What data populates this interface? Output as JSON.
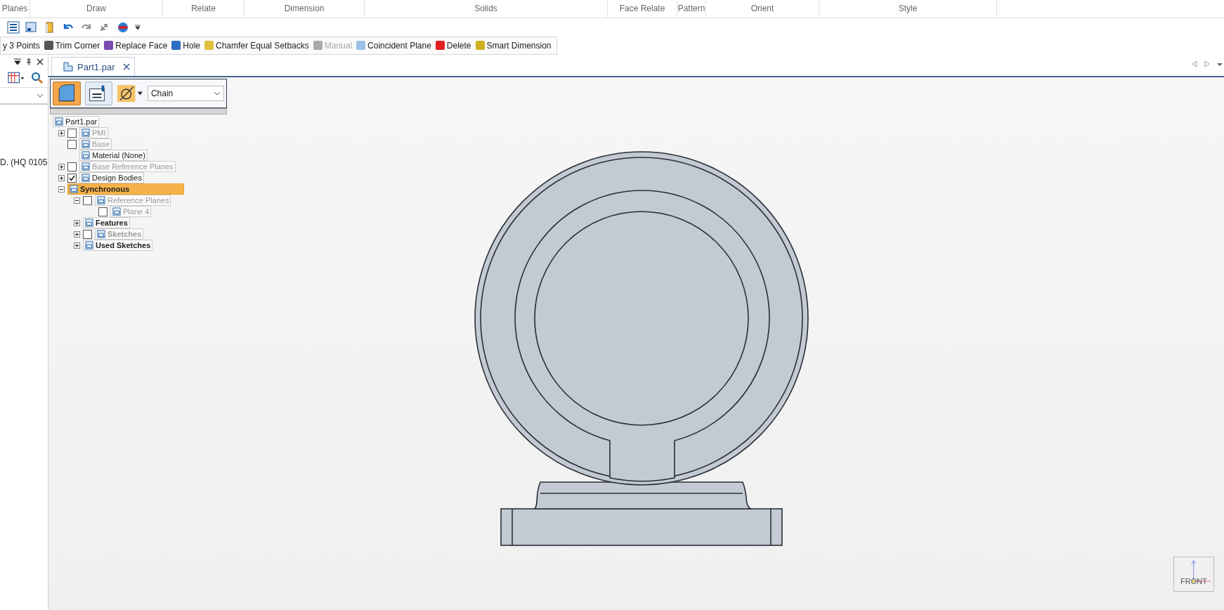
{
  "ribbon": {
    "groups": [
      "Planes",
      "Draw",
      "Relate",
      "Dimension",
      "Solids",
      "Face Relate",
      "Pattern",
      "Orient",
      "Style"
    ]
  },
  "command_bar": {
    "items": [
      {
        "label": "y 3 Points",
        "disabled": false
      },
      {
        "label": "Trim Corner",
        "disabled": false
      },
      {
        "label": "Replace Face",
        "disabled": false
      },
      {
        "label": "Hole",
        "disabled": false
      },
      {
        "label": "Chamfer Equal Setbacks",
        "disabled": false
      },
      {
        "label": "Manual",
        "disabled": true
      },
      {
        "label": "Coincident Plane",
        "disabled": false
      },
      {
        "label": "Delete",
        "disabled": false
      },
      {
        "label": "Smart Dimension",
        "disabled": false
      }
    ]
  },
  "side_panel": {
    "text": "D. (HQ 0105"
  },
  "document_tab": {
    "title": "Part1.par"
  },
  "tree_toolbar": {
    "selection_mode": "Chain"
  },
  "tree": {
    "label": "Part1.par",
    "selected": false,
    "dimmed": false,
    "bold": false,
    "children": [
      {
        "label": "PMI",
        "expanded": false,
        "checked": false,
        "selected": false,
        "dimmed": true,
        "bold": false
      },
      {
        "label": "Base",
        "checked": false,
        "selected": false,
        "dimmed": true,
        "bold": false
      },
      {
        "label": "Material (None)",
        "selected": false,
        "dimmed": false,
        "bold": false
      },
      {
        "label": "Base Reference Planes",
        "expanded": false,
        "checked": false,
        "selected": false,
        "dimmed": true,
        "bold": false
      },
      {
        "label": "Design Bodies",
        "expanded": false,
        "checked": true,
        "selected": false,
        "dimmed": false,
        "bold": false
      },
      {
        "label": "Synchronous",
        "expanded": true,
        "selected": true,
        "dimmed": false,
        "bold": true,
        "children": [
          {
            "label": "Reference Planes",
            "expanded": true,
            "checked": false,
            "selected": false,
            "dimmed": true,
            "bold": false,
            "children": [
              {
                "label": "Plane 4",
                "checked": false,
                "selected": false,
                "dimmed": true,
                "bold": false
              }
            ]
          },
          {
            "label": "Features",
            "expanded": false,
            "selected": false,
            "dimmed": false,
            "bold": true
          },
          {
            "label": "Sketches",
            "expanded": false,
            "checked": false,
            "selected": false,
            "dimmed": true,
            "bold": true
          },
          {
            "label": "Used Sketches",
            "expanded": false,
            "selected": false,
            "dimmed": false,
            "bold": true
          }
        ]
      }
    ]
  },
  "view_cube": {
    "label": "FRONT"
  }
}
